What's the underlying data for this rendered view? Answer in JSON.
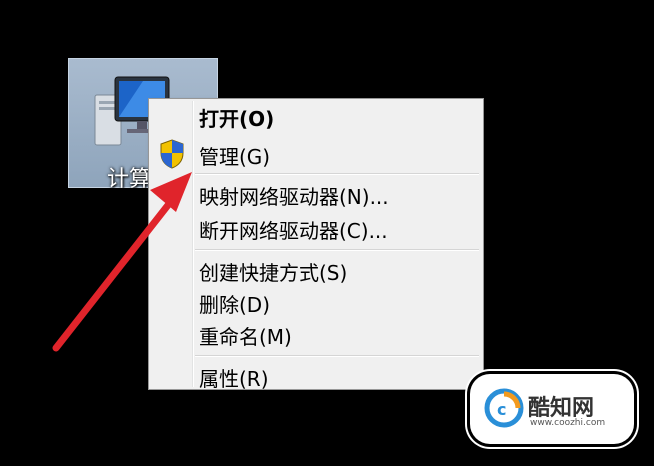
{
  "desktop": {
    "icon_label": "计算"
  },
  "context_menu": {
    "items": [
      {
        "label": "打开(O)",
        "bold": true
      },
      {
        "label": "管理(G)",
        "icon": "shield-icon"
      },
      {
        "label": "映射网络驱动器(N)..."
      },
      {
        "label": "断开网络驱动器(C)..."
      },
      {
        "label": "创建快捷方式(S)"
      },
      {
        "label": "删除(D)"
      },
      {
        "label": "重命名(M)"
      },
      {
        "label": "属性(R)"
      }
    ]
  },
  "annotation": {
    "arrow_color": "#e0242b"
  },
  "watermark": {
    "name": "酷知网",
    "url": "www.coozhi.com"
  }
}
